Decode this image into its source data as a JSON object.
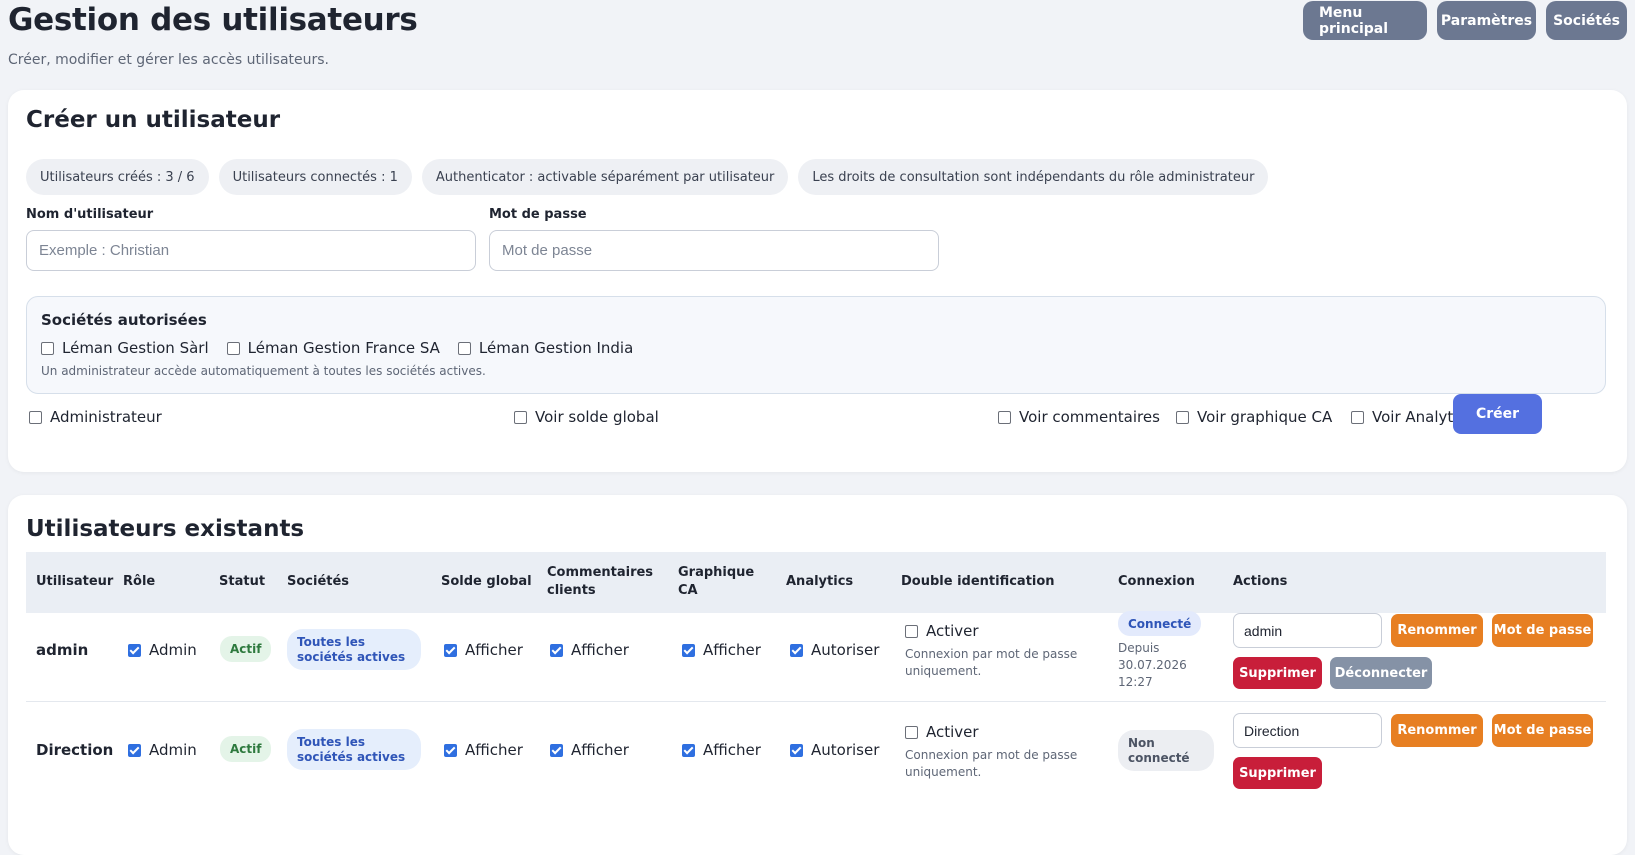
{
  "page": {
    "title": "Gestion des utilisateurs",
    "subtitle": "Créer, modifier et gérer les accès utilisateurs."
  },
  "nav": {
    "main_menu": "Menu principal",
    "settings": "Paramètres",
    "companies": "Sociétés"
  },
  "create": {
    "title": "Créer un utilisateur",
    "pills": {
      "created": "Utilisateurs créés : 3 / 6",
      "connected": "Utilisateurs connectés : 1",
      "authenticator": "Authenticator : activable séparément par utilisateur",
      "rights": "Les droits de consultation sont indépendants du rôle administrateur"
    },
    "username": {
      "label": "Nom d'utilisateur",
      "placeholder": "Exemple : Christian",
      "value": ""
    },
    "password": {
      "label": "Mot de passe",
      "placeholder": "Mot de passe",
      "value": ""
    },
    "companies": {
      "title": "Sociétés autorisées",
      "items": [
        {
          "label": "Léman Gestion Sàrl",
          "checked": false
        },
        {
          "label": "Léman Gestion France SA",
          "checked": false
        },
        {
          "label": "Léman Gestion India",
          "checked": false
        }
      ],
      "note": "Un administrateur accède automatiquement à toutes les sociétés actives."
    },
    "permissions": {
      "admin": "Administrateur",
      "global_balance": "Voir solde global",
      "comments": "Voir commentaires",
      "chart": "Voir graphique CA",
      "analytics": "Voir Analytics"
    },
    "submit": "Créer"
  },
  "users": {
    "title": "Utilisateurs existants",
    "columns": {
      "user": "Utilisateur",
      "role": "Rôle",
      "status": "Statut",
      "companies": "Sociétés",
      "balance": "Solde global",
      "comments": "Commentaires clients",
      "chart": "Graphique CA",
      "analytics": "Analytics",
      "twofa": "Double identification",
      "connection": "Connexion",
      "actions": "Actions"
    },
    "rows": [
      {
        "name": "admin",
        "role": "Admin",
        "status": "Actif",
        "companies": "Toutes les sociétés actives",
        "balance": "Afficher",
        "comments": "Afficher",
        "chart": "Afficher",
        "analytics": "Autoriser",
        "twofa_label": "Activer",
        "twofa_note": "Connexion par mot de passe uniquement.",
        "connection_badge": "Connecté",
        "connection_since": "Depuis 30.07.2026 12:27",
        "rename_value": "admin",
        "rename_label": "Renommer",
        "password_label": "Mot de passe",
        "delete_label": "Supprimer",
        "disconnect_label": "Déconnecter"
      },
      {
        "name": "Direction",
        "role": "Admin",
        "status": "Actif",
        "companies": "Toutes les sociétés actives",
        "balance": "Afficher",
        "comments": "Afficher",
        "chart": "Afficher",
        "analytics": "Autoriser",
        "twofa_label": "Activer",
        "twofa_note": "Connexion par mot de passe uniquement.",
        "connection_badge": "Non connecté",
        "rename_value": "Direction",
        "rename_label": "Renommer",
        "password_label": "Mot de passe",
        "delete_label": "Supprimer"
      }
    ]
  },
  "colors": {
    "background": "#f1f3f7",
    "nav_button": "#6c7891",
    "primary": "#5470e0",
    "orange": "#e77f22",
    "red": "#c81e3a",
    "gray_button": "#8592a6",
    "checkbox": "#2f6fe0"
  }
}
